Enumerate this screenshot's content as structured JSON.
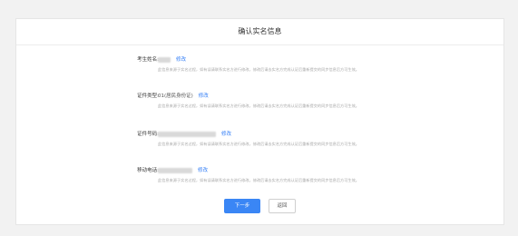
{
  "page": {
    "title": "确认实名信息",
    "fields": [
      {
        "label": "考生姓名:",
        "value": "",
        "value_blurred": true,
        "edit": "修改",
        "tip": "此信息来源于实名过程，如有误请联系实名方进行修改，修改后请去实名方完成认证后重新提交的同步信息后方可生效。"
      },
      {
        "label": "证件类型:",
        "value": "01(居民身份证)",
        "value_blurred": false,
        "edit": "修改",
        "tip": "此信息来源于实名过程，如有误请联系实名方进行修改，修改后请去实名方完成认证后重新提交的同步信息后方可生效。"
      },
      {
        "label": "证件号码:",
        "value": "",
        "value_blurred": true,
        "edit": "修改",
        "tip": "此信息来源于实名过程，如有误请联系实名方进行修改，修改后请去实名方完成认证后重新提交的同步信息后方可生效。"
      },
      {
        "label": "移动电话:",
        "value": "",
        "value_blurred": true,
        "edit": "修改",
        "tip": "此信息来源于实名过程，如有误请联系实名方进行修改，修改后请去实名方完成认证后重新提交的同步信息后方可生效。"
      }
    ],
    "buttons": {
      "next": "下一步",
      "back": "返回"
    }
  },
  "colors": {
    "accent": "#3a86f5",
    "link": "#2f7cf6",
    "tip": "#a9a9a9",
    "background": "#f2f2f2"
  }
}
